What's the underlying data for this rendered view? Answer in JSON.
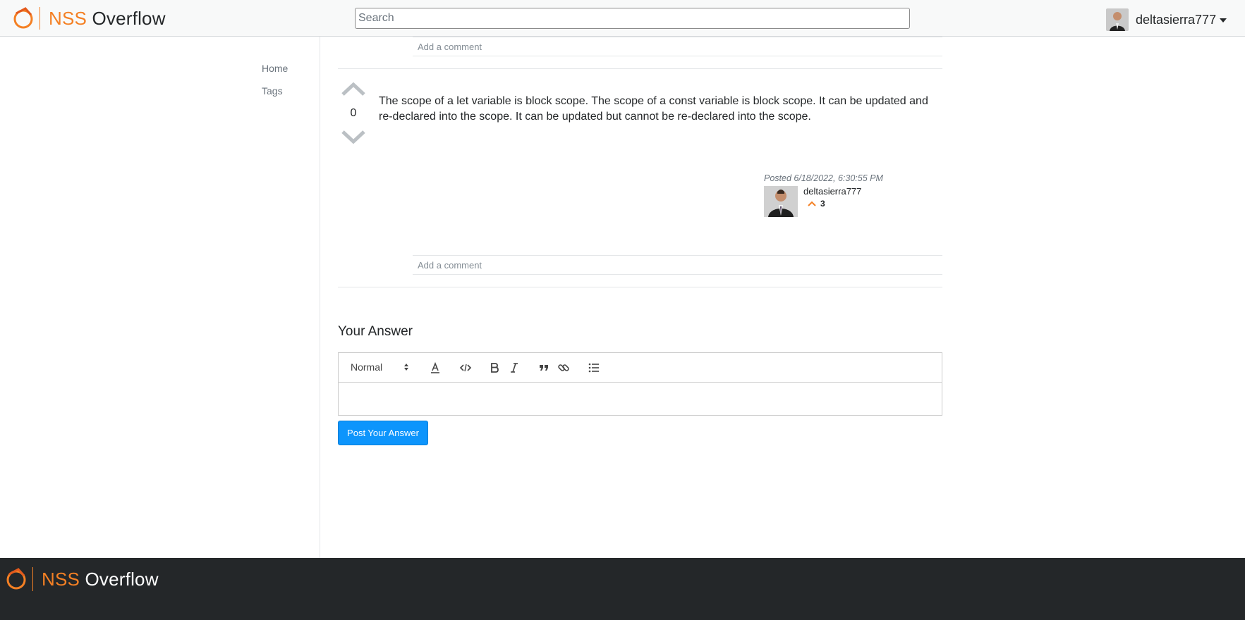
{
  "brand": {
    "nss": "NSS",
    "overflow": "Overflow"
  },
  "search": {
    "placeholder": "Search",
    "value": ""
  },
  "user": {
    "name": "deltasierra777"
  },
  "nav": {
    "home": "Home",
    "tags": "Tags"
  },
  "comments": {
    "add_comment_label": "Add a comment"
  },
  "answer": {
    "vote_count": "0",
    "body": "The scope of a let variable is block scope. The scope of a const variable is block scope. It can be updated and re-declared into the scope. It can be updated but cannot be re-declared into the scope.",
    "posted": "Posted 6/18/2022, 6:30:55 PM",
    "author": "deltasierra777",
    "author_rep": "3"
  },
  "your_answer": {
    "title": "Your Answer",
    "format": "Normal",
    "submit_label": "Post Your Answer"
  },
  "footer": {
    "nss": "NSS",
    "overflow": "Overflow"
  },
  "colors": {
    "brand_orange": "#f48024",
    "button_blue": "#0d95fc",
    "footer_bg": "#242729"
  },
  "icons": [
    "brand-logo-icon",
    "chevron-down-icon",
    "vote-up-icon",
    "vote-down-icon",
    "reputation-up-icon",
    "font-color-icon",
    "code-icon",
    "bold-icon",
    "italic-icon",
    "blockquote-icon",
    "link-icon",
    "bullet-list-icon"
  ]
}
